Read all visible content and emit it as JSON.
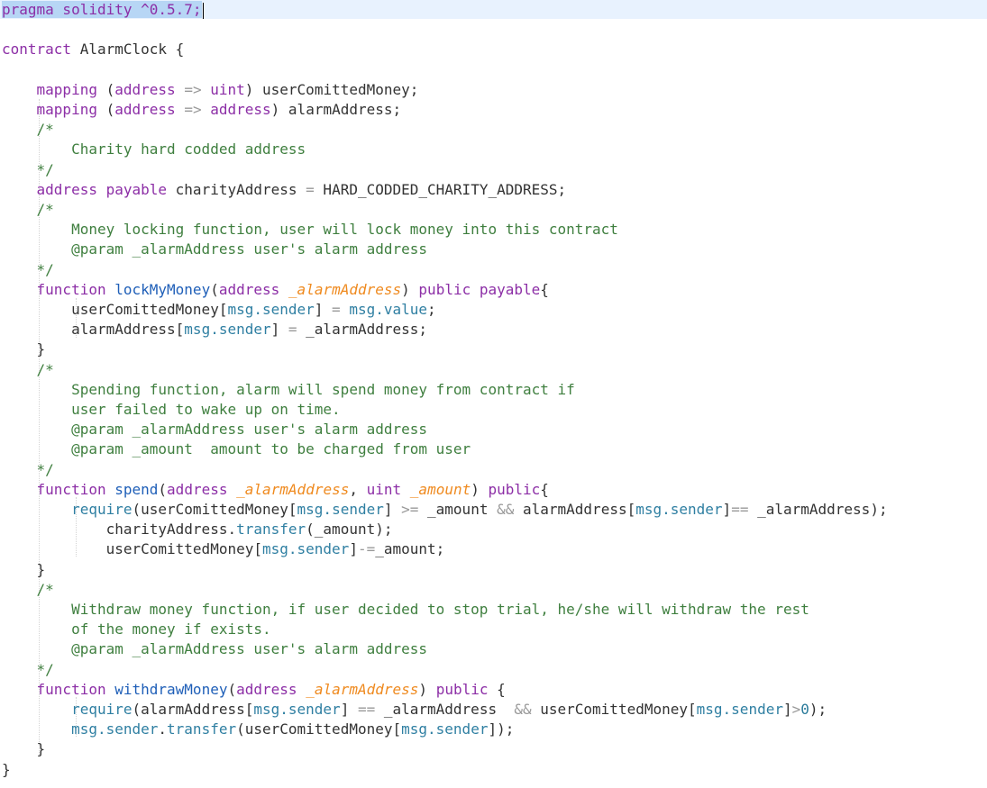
{
  "editor": {
    "language": "Solidity",
    "selected_text": "pragma solidity ^0.5.7;",
    "current_line": 1,
    "colors": {
      "keyword": "#8c2ea6",
      "function_name": "#1f5fb8",
      "parameter": "#ef8a1f",
      "comment": "#3f7f3f",
      "builtin": "#2f7fa2",
      "operator": "#999999",
      "plain": "#333333",
      "selection": "#b7d6f5",
      "current_line_bg": "#e8f2fe"
    },
    "lines": [
      [
        {
          "t": "pragma solidity ^0.5.7;",
          "c": "kw sel"
        }
      ],
      [],
      [
        {
          "t": "contract",
          "c": "kw"
        },
        {
          "t": " AlarmClock {"
        }
      ],
      [],
      [
        {
          "t": "    "
        },
        {
          "t": "mapping",
          "c": "kw"
        },
        {
          "t": " ("
        },
        {
          "t": "address",
          "c": "ty"
        },
        {
          "t": " "
        },
        {
          "t": "=>",
          "c": "op"
        },
        {
          "t": " "
        },
        {
          "t": "uint",
          "c": "ty"
        },
        {
          "t": ") userComittedMoney;"
        }
      ],
      [
        {
          "t": "    "
        },
        {
          "t": "mapping",
          "c": "kw"
        },
        {
          "t": " ("
        },
        {
          "t": "address",
          "c": "ty"
        },
        {
          "t": " "
        },
        {
          "t": "=>",
          "c": "op"
        },
        {
          "t": " "
        },
        {
          "t": "address",
          "c": "ty"
        },
        {
          "t": ") alarmAddress;"
        }
      ],
      [
        {
          "t": "    /*",
          "c": "co"
        }
      ],
      [
        {
          "t": "        Charity hard codded address",
          "c": "co"
        }
      ],
      [
        {
          "t": "    */",
          "c": "co"
        }
      ],
      [
        {
          "t": "    "
        },
        {
          "t": "address payable",
          "c": "kw"
        },
        {
          "t": " charityAddress "
        },
        {
          "t": "=",
          "c": "op"
        },
        {
          "t": " HARD_CODDED_CHARITY_ADDRESS;"
        }
      ],
      [
        {
          "t": "    /*",
          "c": "co"
        }
      ],
      [
        {
          "t": "        Money locking function, user will lock money into this contract",
          "c": "co"
        }
      ],
      [
        {
          "t": "        @param _alarmAddress user's alarm address",
          "c": "co"
        }
      ],
      [
        {
          "t": "    */",
          "c": "co"
        }
      ],
      [
        {
          "t": "    "
        },
        {
          "t": "function",
          "c": "kw"
        },
        {
          "t": " "
        },
        {
          "t": "lockMyMoney",
          "c": "fn"
        },
        {
          "t": "("
        },
        {
          "t": "address",
          "c": "ty"
        },
        {
          "t": " "
        },
        {
          "t": "_alarmAddress",
          "c": "pa"
        },
        {
          "t": ") "
        },
        {
          "t": "public payable",
          "c": "kw"
        },
        {
          "t": "{"
        }
      ],
      [
        {
          "t": "        userComittedMoney["
        },
        {
          "t": "msg.sender",
          "c": "gl"
        },
        {
          "t": "] "
        },
        {
          "t": "=",
          "c": "op"
        },
        {
          "t": " "
        },
        {
          "t": "msg.value",
          "c": "gl"
        },
        {
          "t": ";"
        }
      ],
      [
        {
          "t": "        alarmAddress["
        },
        {
          "t": "msg.sender",
          "c": "gl"
        },
        {
          "t": "] "
        },
        {
          "t": "=",
          "c": "op"
        },
        {
          "t": " _alarmAddress;"
        }
      ],
      [
        {
          "t": "    }"
        }
      ],
      [
        {
          "t": "    /*",
          "c": "co"
        }
      ],
      [
        {
          "t": "        Spending function, alarm will spend money from contract if",
          "c": "co"
        }
      ],
      [
        {
          "t": "        user failed to wake up on time.",
          "c": "co"
        }
      ],
      [
        {
          "t": "        @param _alarmAddress user's alarm address",
          "c": "co"
        }
      ],
      [
        {
          "t": "        @param _amount  amount to be charged from user",
          "c": "co"
        }
      ],
      [
        {
          "t": "    */",
          "c": "co"
        }
      ],
      [
        {
          "t": "    "
        },
        {
          "t": "function",
          "c": "kw"
        },
        {
          "t": " "
        },
        {
          "t": "spend",
          "c": "fn"
        },
        {
          "t": "("
        },
        {
          "t": "address",
          "c": "ty"
        },
        {
          "t": " "
        },
        {
          "t": "_alarmAddress",
          "c": "pa"
        },
        {
          "t": ", "
        },
        {
          "t": "uint",
          "c": "ty"
        },
        {
          "t": " "
        },
        {
          "t": "_amount",
          "c": "pa"
        },
        {
          "t": ") "
        },
        {
          "t": "public",
          "c": "kw"
        },
        {
          "t": "{"
        }
      ],
      [
        {
          "t": "        "
        },
        {
          "t": "require",
          "c": "gl"
        },
        {
          "t": "(userComittedMoney["
        },
        {
          "t": "msg.sender",
          "c": "gl"
        },
        {
          "t": "] "
        },
        {
          "t": ">=",
          "c": "op"
        },
        {
          "t": " _amount "
        },
        {
          "t": "&&",
          "c": "op"
        },
        {
          "t": " alarmAddress["
        },
        {
          "t": "msg.sender",
          "c": "gl"
        },
        {
          "t": "]"
        },
        {
          "t": "==",
          "c": "op"
        },
        {
          "t": " _alarmAddress);"
        }
      ],
      [
        {
          "t": "            charityAddress."
        },
        {
          "t": "transfer",
          "c": "gl"
        },
        {
          "t": "(_amount);"
        }
      ],
      [
        {
          "t": "            userComittedMoney["
        },
        {
          "t": "msg.sender",
          "c": "gl"
        },
        {
          "t": "]"
        },
        {
          "t": "-=",
          "c": "op"
        },
        {
          "t": "_amount;"
        }
      ],
      [
        {
          "t": "    }"
        }
      ],
      [
        {
          "t": "    /*",
          "c": "co"
        }
      ],
      [
        {
          "t": "        Withdraw money function, if user decided to stop trial, he/she will withdraw the rest",
          "c": "co"
        }
      ],
      [
        {
          "t": "        of the money if exists.",
          "c": "co"
        }
      ],
      [
        {
          "t": "        @param _alarmAddress user's alarm address",
          "c": "co"
        }
      ],
      [
        {
          "t": "    */",
          "c": "co"
        }
      ],
      [
        {
          "t": "    "
        },
        {
          "t": "function",
          "c": "kw"
        },
        {
          "t": " "
        },
        {
          "t": "withdrawMoney",
          "c": "fn"
        },
        {
          "t": "("
        },
        {
          "t": "address",
          "c": "ty"
        },
        {
          "t": " "
        },
        {
          "t": "_alarmAddress",
          "c": "pa"
        },
        {
          "t": ") "
        },
        {
          "t": "public",
          "c": "kw"
        },
        {
          "t": " {"
        }
      ],
      [
        {
          "t": "        "
        },
        {
          "t": "require",
          "c": "gl"
        },
        {
          "t": "(alarmAddress["
        },
        {
          "t": "msg.sender",
          "c": "gl"
        },
        {
          "t": "] "
        },
        {
          "t": "==",
          "c": "op"
        },
        {
          "t": " _alarmAddress  "
        },
        {
          "t": "&&",
          "c": "op"
        },
        {
          "t": " userComittedMoney["
        },
        {
          "t": "msg.sender",
          "c": "gl"
        },
        {
          "t": "]"
        },
        {
          "t": ">",
          "c": "op"
        },
        {
          "t": "0",
          "c": "nu"
        },
        {
          "t": ");"
        }
      ],
      [
        {
          "t": "        "
        },
        {
          "t": "msg.sender",
          "c": "gl"
        },
        {
          "t": "."
        },
        {
          "t": "transfer",
          "c": "gl"
        },
        {
          "t": "(userComittedMoney["
        },
        {
          "t": "msg.sender",
          "c": "gl"
        },
        {
          "t": "]);"
        }
      ],
      [
        {
          "t": "    }"
        }
      ],
      [
        {
          "t": "}"
        }
      ]
    ]
  }
}
